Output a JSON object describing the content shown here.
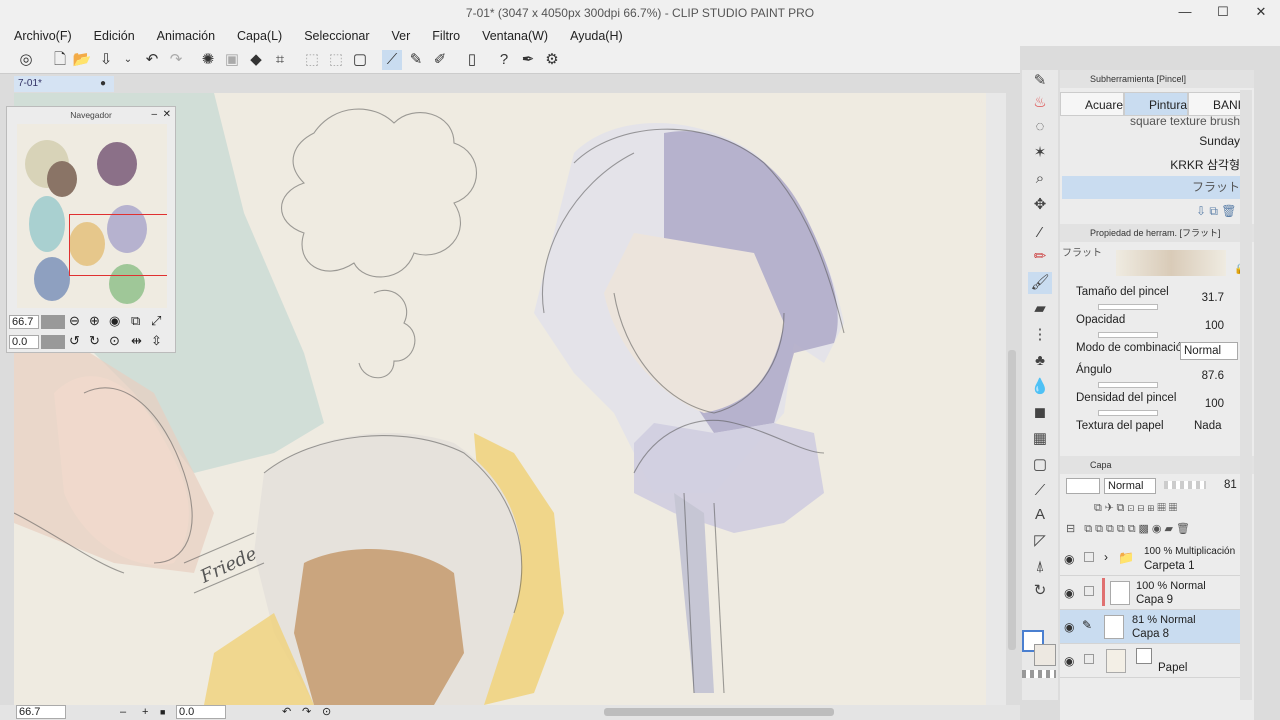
{
  "window": {
    "title": "7-01* (3047 x 4050px 300dpi 66.7%) - CLIP STUDIO PAINT PRO",
    "controls": [
      "—",
      "☐",
      "✕"
    ]
  },
  "menu": [
    "Archivo(F)",
    "Edición",
    "Animación",
    "Capa(L)",
    "Seleccionar",
    "Ver",
    "Filtro",
    "Ventana(W)",
    "Ayuda(H)"
  ],
  "tab": {
    "label": "7-01*",
    "dot": "●"
  },
  "navigator": {
    "title": "Navegador",
    "zoom": "66.7",
    "angle": "0.0"
  },
  "status": {
    "zoom": "66.7",
    "angle": "0.0"
  },
  "canvas": {
    "signature": "Friede"
  },
  "subtool": {
    "title": "Subherramienta [Pincel]",
    "tabs": [
      "Acuare",
      "Pintura",
      "BANI"
    ],
    "brushes": [
      "square texture brush",
      "Sunday",
      "KRKR 삼각형",
      "フラット"
    ]
  },
  "toolprop": {
    "title": "Propiedad de herram. [フラット]",
    "preset": "フラット",
    "rows": [
      {
        "label": "Tamaño del pincel",
        "value": "31.7"
      },
      {
        "label": "Opacidad",
        "value": "100"
      },
      {
        "label": "Modo de combinación",
        "value": "Normal"
      },
      {
        "label": "Ángulo",
        "value": "87.6"
      },
      {
        "label": "Densidad del pincel",
        "value": "100"
      },
      {
        "label": "Textura del papel",
        "value": "Nada"
      }
    ]
  },
  "layers": {
    "title": "Capa",
    "blend": "Normal",
    "opacity": "81",
    "items": [
      {
        "pct": "100 % Multiplicación",
        "name": "Carpeta 1"
      },
      {
        "pct": "100 % Normal",
        "name": "Capa 9"
      },
      {
        "pct": "81 % Normal",
        "name": "Capa 8"
      },
      {
        "pct": "",
        "name": "Papel"
      }
    ]
  }
}
